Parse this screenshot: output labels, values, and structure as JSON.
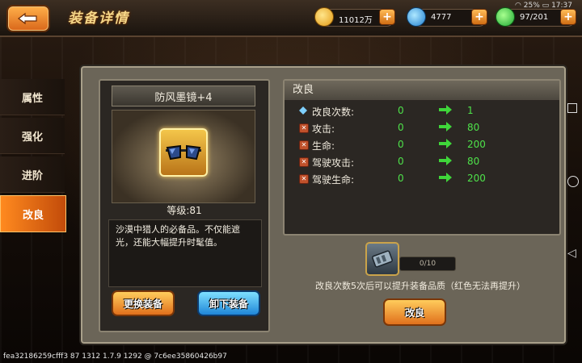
{
  "header": {
    "title": "装备详情",
    "resources": [
      {
        "icon": "gold-coin-icon",
        "value": "11012万",
        "color": "#f5b22a"
      },
      {
        "icon": "blue-gem-icon",
        "value": "4777",
        "color": "#2f9ee6"
      },
      {
        "icon": "green-stamina-icon",
        "value": "97/201",
        "color": "#2fcc3f"
      }
    ],
    "status": {
      "battery": "25%",
      "time": "17:37"
    }
  },
  "sidebar": {
    "items": [
      {
        "label": "属性"
      },
      {
        "label": "强化"
      },
      {
        "label": "进阶"
      },
      {
        "label": "改良"
      }
    ],
    "active_index": 3
  },
  "item": {
    "name": "防风墨镜+4",
    "level": "等级:81",
    "description": "沙漠中猎人的必备品。不仅能遮光，还能大幅提升时髦值。",
    "change_button": "更换装备",
    "unequip_button": "卸下装备"
  },
  "refine": {
    "title": "改良",
    "rows": [
      {
        "label": "改良次数:",
        "from": "0",
        "to": "1",
        "marker": "diamond"
      },
      {
        "label": "攻击:",
        "from": "0",
        "to": "80",
        "marker": "x"
      },
      {
        "label": "生命:",
        "from": "0",
        "to": "200",
        "marker": "x"
      },
      {
        "label": "驾驶攻击:",
        "from": "0",
        "to": "80",
        "marker": "x"
      },
      {
        "label": "驾驶生命:",
        "from": "0",
        "to": "200",
        "marker": "x"
      }
    ],
    "material_progress": "0/10",
    "hint": "改良次数5次后可以提升装备品质（红色无法再提升）",
    "button": "改良"
  },
  "footer": {
    "build": "fea32186259cfff3 87 1312 1.7.9 1292 @ 7c6ee35860426b97"
  }
}
